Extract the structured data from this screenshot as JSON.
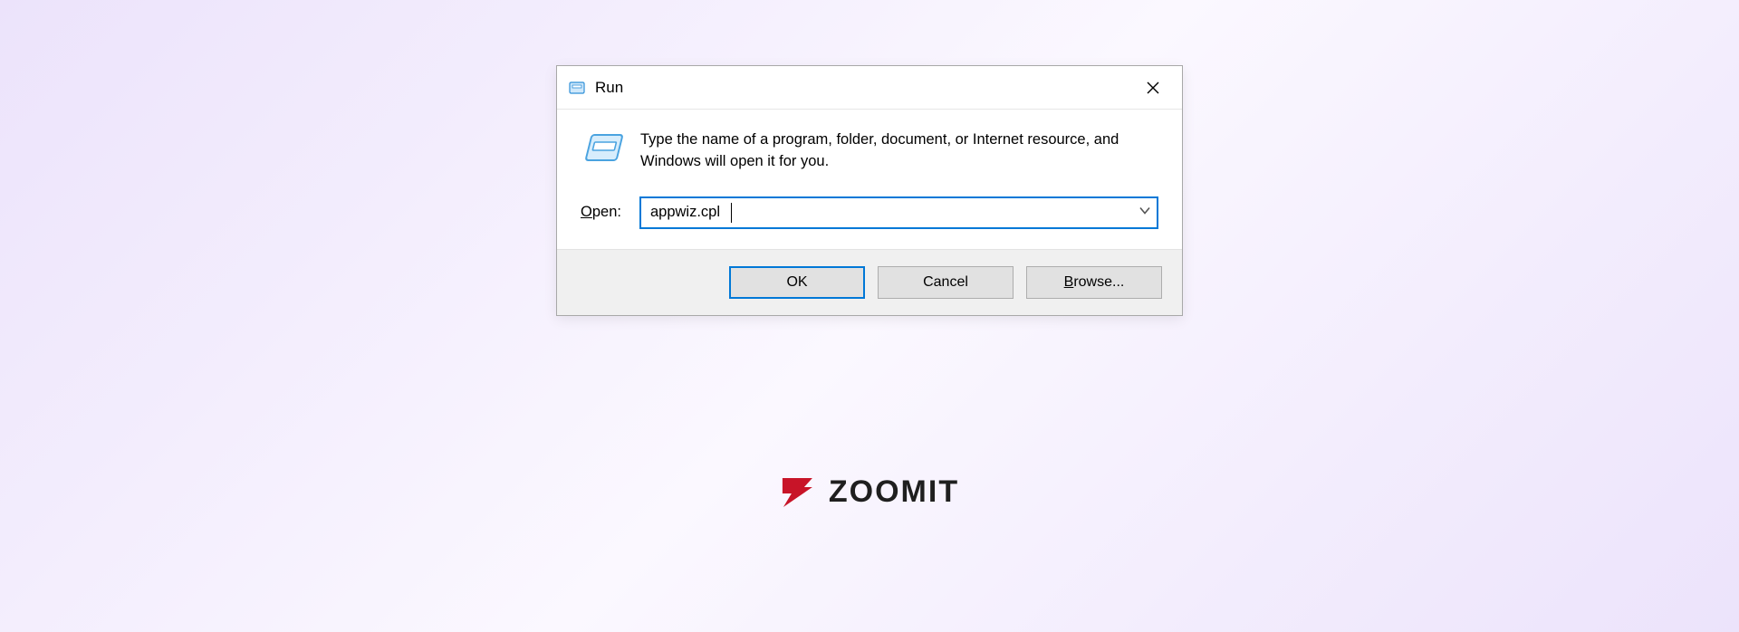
{
  "dialog": {
    "title": "Run",
    "description": "Type the name of a program, folder, document, or Internet resource, and Windows will open it for you.",
    "open_label_prefix": "O",
    "open_label_rest": "pen:",
    "input_value": "appwiz.cpl",
    "buttons": {
      "ok": "OK",
      "cancel": "Cancel",
      "browse_prefix": "B",
      "browse_rest": "rowse..."
    }
  },
  "watermark": {
    "text": "ZOOMIT"
  }
}
